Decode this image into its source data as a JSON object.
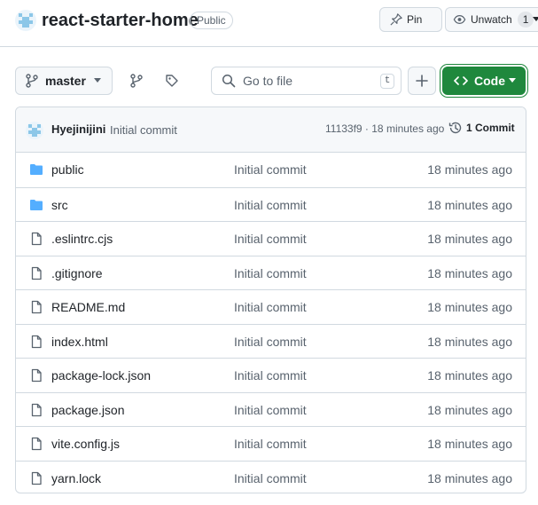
{
  "repo": {
    "name": "react-starter-home",
    "visibility": "Public"
  },
  "actions": {
    "pin_label": "Pin",
    "watch_label": "Unwatch",
    "watch_count": "1"
  },
  "toolbar": {
    "branch": "master",
    "search_placeholder": "Go to file",
    "search_shortcut": "t",
    "code_label": "Code"
  },
  "commit": {
    "author": "Hyejinijini",
    "message": "Initial commit",
    "meta": "11133f9 · 18 minutes ago",
    "count_label": "1 Commit"
  },
  "files": [
    {
      "name": "public",
      "type": "folder",
      "commit": "Initial commit",
      "time": "18 minutes ago"
    },
    {
      "name": "src",
      "type": "folder",
      "commit": "Initial commit",
      "time": "18 minutes ago"
    },
    {
      "name": ".eslintrc.cjs",
      "type": "file",
      "commit": "Initial commit",
      "time": "18 minutes ago"
    },
    {
      "name": ".gitignore",
      "type": "file",
      "commit": "Initial commit",
      "time": "18 minutes ago"
    },
    {
      "name": "README.md",
      "type": "file",
      "commit": "Initial commit",
      "time": "18 minutes ago"
    },
    {
      "name": "index.html",
      "type": "file",
      "commit": "Initial commit",
      "time": "18 minutes ago"
    },
    {
      "name": "package-lock.json",
      "type": "file",
      "commit": "Initial commit",
      "time": "18 minutes ago"
    },
    {
      "name": "package.json",
      "type": "file",
      "commit": "Initial commit",
      "time": "18 minutes ago"
    },
    {
      "name": "vite.config.js",
      "type": "file",
      "commit": "Initial commit",
      "time": "18 minutes ago"
    },
    {
      "name": "yarn.lock",
      "type": "file",
      "commit": "Initial commit",
      "time": "18 minutes ago"
    }
  ],
  "colors": {
    "folder": "#54aeff",
    "code_button": "#1f883d",
    "muted_text": "#59636e",
    "border": "#d1d9e0"
  }
}
